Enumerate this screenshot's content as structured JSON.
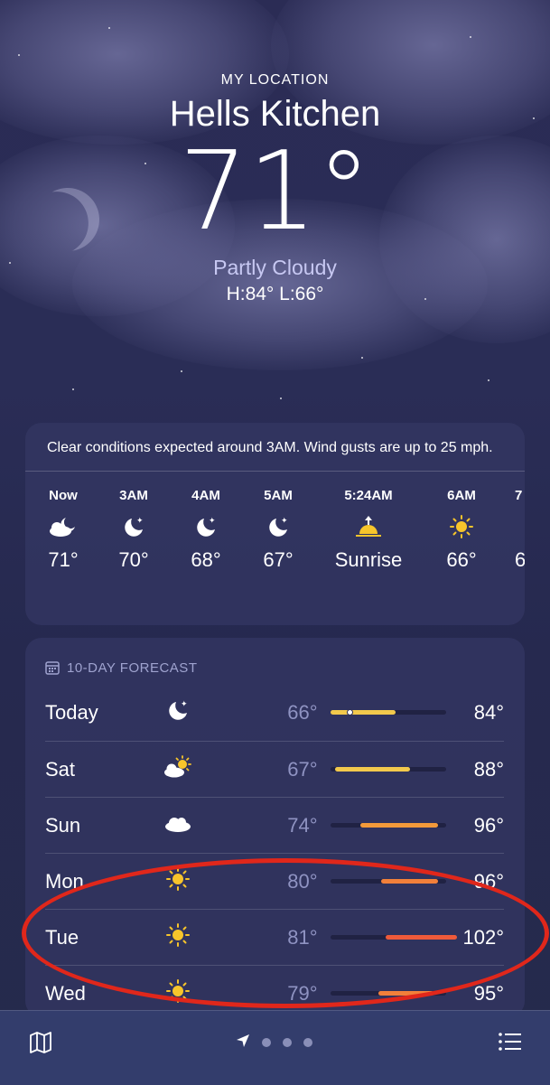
{
  "location": {
    "label": "MY LOCATION",
    "city": "Hells Kitchen",
    "temperature": "71°",
    "condition": "Partly Cloudy",
    "hilo": "H:84°  L:66°"
  },
  "hourly": {
    "summary": "Clear conditions expected around 3AM. Wind gusts are up to 25 mph.",
    "items": [
      {
        "time": "Now",
        "icon": "moon-cloud-icon",
        "temp": "71°"
      },
      {
        "time": "3AM",
        "icon": "moon-stars-icon",
        "temp": "70°"
      },
      {
        "time": "4AM",
        "icon": "moon-stars-icon",
        "temp": "68°"
      },
      {
        "time": "5AM",
        "icon": "moon-stars-icon",
        "temp": "67°"
      },
      {
        "time": "5:24AM",
        "icon": "sunrise-icon",
        "temp": "Sunrise"
      },
      {
        "time": "6AM",
        "icon": "sun-icon",
        "temp": "66°"
      },
      {
        "time": "7",
        "icon": "sun-icon",
        "temp": "6"
      }
    ]
  },
  "forecast": {
    "title": "10-DAY FORECAST",
    "days": [
      {
        "day": "Today",
        "icon": "moon-stars-icon",
        "low": "66°",
        "high": "84°",
        "range": [
          0.0,
          0.52
        ],
        "current": 0.16,
        "color": "#f2c94c"
      },
      {
        "day": "Sat",
        "icon": "sun-cloud-icon",
        "low": "67°",
        "high": "88°",
        "range": [
          0.04,
          0.63
        ],
        "color": "#f2c94c"
      },
      {
        "day": "Sun",
        "icon": "cloud-icon",
        "low": "74°",
        "high": "96°",
        "range": [
          0.24,
          0.85
        ],
        "color": "#f39a3a"
      },
      {
        "day": "Mon",
        "icon": "sun-icon",
        "low": "80°",
        "high": "96°",
        "range": [
          0.4,
          0.85
        ],
        "color": "#f2803a"
      },
      {
        "day": "Tue",
        "icon": "sun-icon",
        "low": "81°",
        "high": "102°",
        "range": [
          0.44,
          1.0
        ],
        "color": "#ee5a3a"
      },
      {
        "day": "Wed",
        "icon": "sun-icon",
        "low": "79°",
        "high": "95°",
        "range": [
          0.38,
          0.82
        ],
        "color": "#f2803a"
      }
    ]
  },
  "tabbar": {
    "map_icon": "map-icon",
    "list_icon": "list-icon",
    "location_icon": "location-arrow-icon"
  },
  "annotation_color": "#e0271b"
}
